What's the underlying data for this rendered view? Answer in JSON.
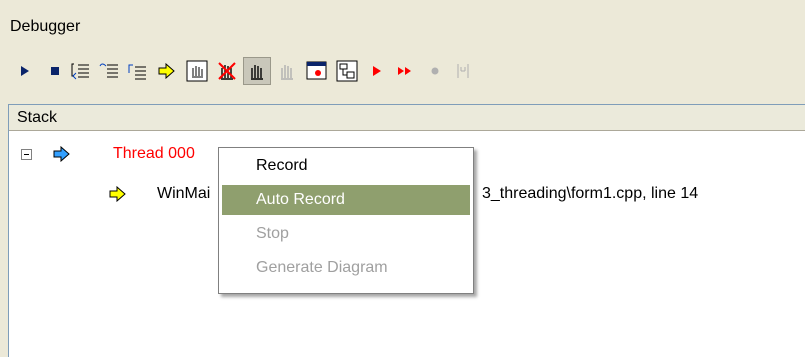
{
  "window": {
    "title": "Debugger"
  },
  "toolbar": {
    "buttons": [
      {
        "icon": "run-icon"
      },
      {
        "icon": "stop-icon"
      },
      {
        "icon": "step-into-icon"
      },
      {
        "icon": "step-over-icon"
      },
      {
        "icon": "step-out-icon"
      },
      {
        "icon": "show-next-statement-icon"
      },
      {
        "icon": "toggle-breakpoint-icon"
      },
      {
        "icon": "clear-breakpoints-icon"
      },
      {
        "icon": "hand-breakpoint-icon"
      },
      {
        "icon": "hand-disabled-icon"
      },
      {
        "icon": "watch-window-icon"
      },
      {
        "icon": "diagram-icon"
      },
      {
        "icon": "record-play-icon"
      },
      {
        "icon": "record-fast-forward-icon"
      },
      {
        "icon": "record-stop-icon"
      },
      {
        "icon": "record-step-icon"
      }
    ],
    "accent_play": "#0a246a",
    "accent_record": "#ff0000"
  },
  "stack": {
    "header": "Stack",
    "thread_label": "Thread 000",
    "frame_prefix": "WinMai",
    "frame_suffix": "3_threading\\form1.cpp, line 14",
    "thread_color": "#ff0000"
  },
  "context_menu": {
    "items": [
      {
        "label": "Record",
        "state": "normal"
      },
      {
        "label": "Auto Record",
        "state": "selected"
      },
      {
        "label": "Stop",
        "state": "disabled"
      },
      {
        "label": "Generate Diagram",
        "state": "disabled"
      }
    ],
    "highlight_color": "#8f9f6e"
  }
}
